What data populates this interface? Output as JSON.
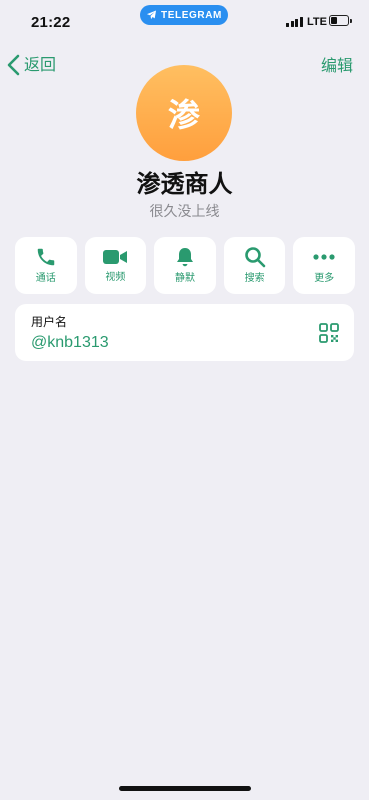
{
  "status_bar": {
    "time": "21:22",
    "center_pill": "TELEGRAM",
    "network": "LTE",
    "battery_level": 0.35
  },
  "nav": {
    "back_label": "返回",
    "edit_label": "编辑"
  },
  "profile": {
    "avatar_initial": "渗",
    "name": "渗透商人",
    "status": "很久没上线"
  },
  "actions": [
    {
      "label": "通话",
      "icon": "phone-icon"
    },
    {
      "label": "视频",
      "icon": "video-icon"
    },
    {
      "label": "静默",
      "icon": "bell-icon"
    },
    {
      "label": "搜索",
      "icon": "search-icon"
    },
    {
      "label": "更多",
      "icon": "more-icon"
    }
  ],
  "info": {
    "label": "用户名",
    "value": "@knb1313"
  },
  "colors": {
    "accent": "#2a9a6f",
    "background": "#efeef4",
    "card": "#ffffff",
    "avatar_top": "#ffbf61",
    "avatar_bottom": "#ff9f3d",
    "pill": "#2a8ff0"
  }
}
